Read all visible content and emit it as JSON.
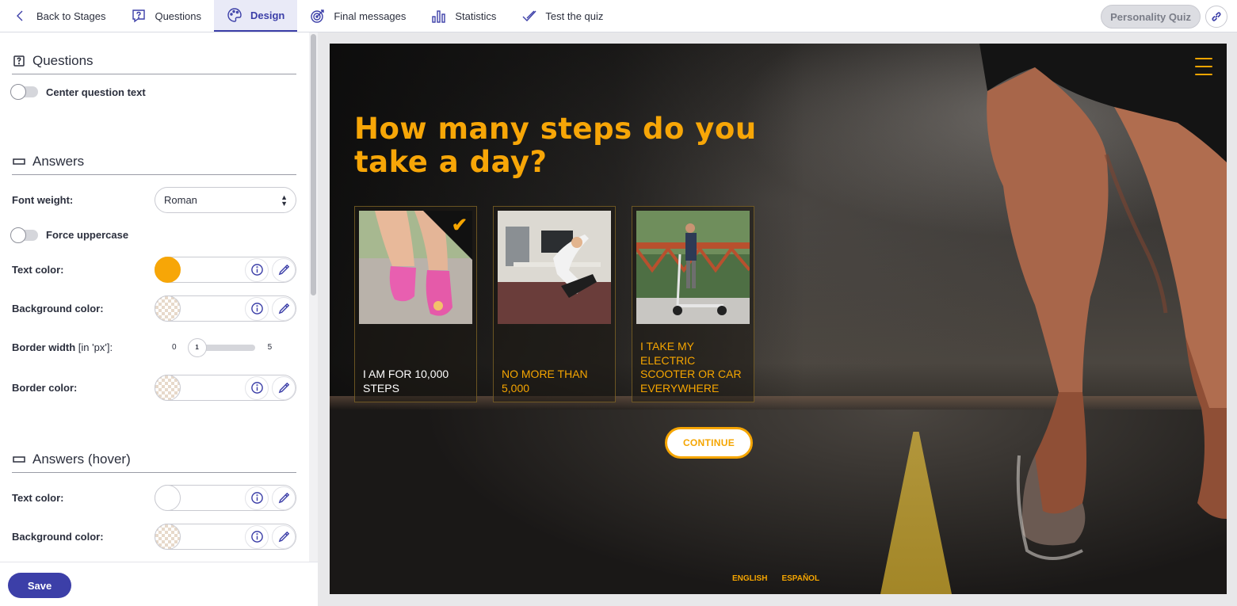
{
  "topnav": {
    "back_label": "Back to Stages",
    "tabs": [
      {
        "label": "Questions"
      },
      {
        "label": "Design"
      },
      {
        "label": "Final messages"
      },
      {
        "label": "Statistics"
      },
      {
        "label": "Test the quiz"
      }
    ],
    "quiz_type": "Personality Quiz"
  },
  "sidebar": {
    "questions_section": {
      "title": "Questions",
      "center_text_label": "Center question text"
    },
    "answers_section": {
      "title": "Answers",
      "font_weight_label": "Font weight:",
      "font_weight_value": "Roman",
      "force_uppercase_label": "Force uppercase",
      "text_color_label": "Text color:",
      "text_color_value": "#f7a607",
      "background_color_label": "Background color:",
      "border_width_label": "Border width",
      "border_width_unit": "[in 'px']:",
      "border_width_min": "0",
      "border_width_max": "5",
      "border_width_value": "1",
      "border_color_label": "Border color:"
    },
    "answers_hover_section": {
      "title": "Answers (hover)",
      "text_color_label": "Text color:",
      "text_color_value": "#ffffff",
      "background_color_label": "Background color:"
    },
    "save_label": "Save"
  },
  "preview": {
    "question": "How many steps do you take a day?",
    "answers": [
      {
        "text": "I am for 10,000 steps",
        "selected": true
      },
      {
        "text": "No more than 5,000",
        "selected": false
      },
      {
        "text": "I take my electric scooter or car everywhere",
        "selected": false
      }
    ],
    "continue_label": "CONTINUE",
    "languages": [
      "ENGLISH",
      "ESPAÑOL"
    ],
    "accent_color": "#f5a500"
  }
}
